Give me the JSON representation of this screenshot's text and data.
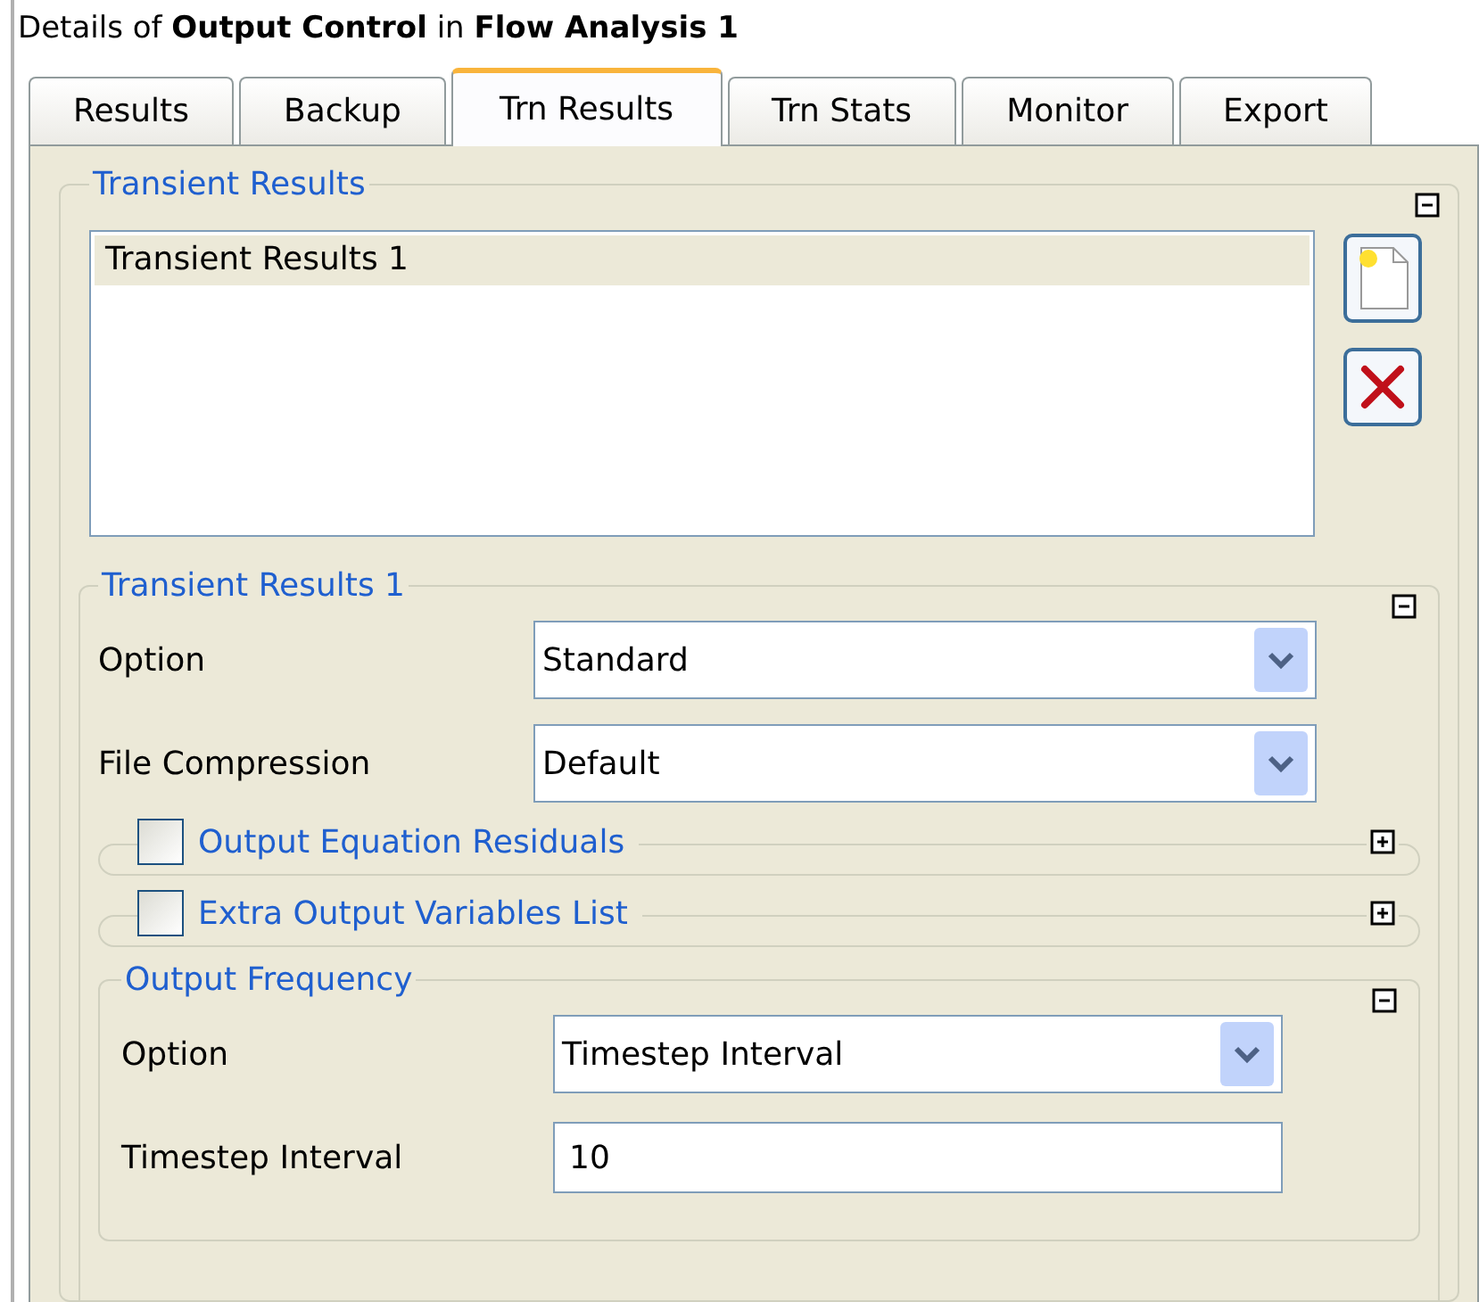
{
  "title": "Details of **Output Control** in **Flow Analysis 1**",
  "tabs": [
    {
      "label": "Results",
      "selected": false
    },
    {
      "label": "Backup",
      "selected": false
    },
    {
      "label": "Trn Results",
      "selected": true
    },
    {
      "label": "Trn Stats",
      "selected": false
    },
    {
      "label": "Monitor",
      "selected": false
    },
    {
      "label": "Export",
      "selected": false
    }
  ],
  "transient_results": {
    "title": "Transient Results",
    "expanded": true,
    "items": [
      {
        "label": "Transient Results 1",
        "selected": true
      }
    ]
  },
  "detail": {
    "title": "Transient Results 1",
    "expanded": true,
    "fields": [
      {
        "kind": "dropdown",
        "label": "Option",
        "value": "Standard"
      },
      {
        "kind": "dropdown",
        "label": "File Compression",
        "value": "Default"
      }
    ],
    "sections": [
      {
        "label": "Output Equation Residuals",
        "checked": false,
        "expanded": false
      },
      {
        "label": "Extra Output Variables List",
        "checked": false,
        "expanded": false
      }
    ],
    "output_frequency": {
      "title": "Output Frequency",
      "expanded": true,
      "fields": [
        {
          "kind": "dropdown",
          "label": "Option",
          "value": "Timestep Interval"
        },
        {
          "kind": "text",
          "label": "Timestep Interval",
          "value": "10"
        }
      ]
    }
  }
}
